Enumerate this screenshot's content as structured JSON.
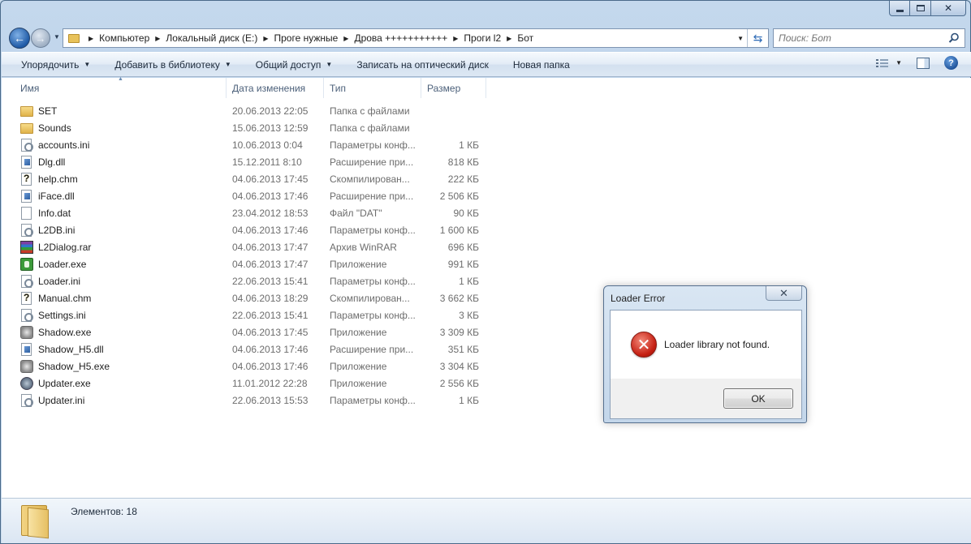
{
  "window": {
    "caption_buttons": {
      "minimize": "minimize",
      "maximize": "maximize",
      "close": "close"
    }
  },
  "address_bar": {
    "crumbs": [
      "Компьютер",
      "Локальный диск (E:)",
      "Проге нужные",
      "Дрова +++++++++++",
      "Проги l2",
      "Бот"
    ]
  },
  "search": {
    "placeholder": "Поиск: Бот"
  },
  "commandbar": {
    "items": [
      {
        "label": "Упорядочить",
        "has_arrow": true
      },
      {
        "label": "Добавить в библиотеку",
        "has_arrow": true
      },
      {
        "label": "Общий доступ",
        "has_arrow": true
      },
      {
        "label": "Записать на оптический диск",
        "has_arrow": false
      },
      {
        "label": "Новая папка",
        "has_arrow": false
      }
    ]
  },
  "columns": {
    "name": "Имя",
    "date": "Дата изменения",
    "type": "Тип",
    "size": "Размер"
  },
  "files": [
    {
      "name": "SET",
      "date": "20.06.2013 22:05",
      "type": "Папка с файлами",
      "size": "",
      "icon": "folder-icon"
    },
    {
      "name": "Sounds",
      "date": "15.06.2013 12:59",
      "type": "Папка с файлами",
      "size": "",
      "icon": "folder-icon"
    },
    {
      "name": "accounts.ini",
      "date": "10.06.2013 0:04",
      "type": "Параметры конф...",
      "size": "1 КБ",
      "icon": "ini-file-icon"
    },
    {
      "name": "Dlg.dll",
      "date": "15.12.2011 8:10",
      "type": "Расширение при...",
      "size": "818 КБ",
      "icon": "dll-file-icon"
    },
    {
      "name": "help.chm",
      "date": "04.06.2013 17:45",
      "type": "Скомпилирован...",
      "size": "222 КБ",
      "icon": "chm-file-icon"
    },
    {
      "name": "iFace.dll",
      "date": "04.06.2013 17:46",
      "type": "Расширение при...",
      "size": "2 506 КБ",
      "icon": "dll-file-icon"
    },
    {
      "name": "Info.dat",
      "date": "23.04.2012 18:53",
      "type": "Файл \"DAT\"",
      "size": "90 КБ",
      "icon": "blank-file-icon"
    },
    {
      "name": "L2DB.ini",
      "date": "04.06.2013 17:46",
      "type": "Параметры конф...",
      "size": "1 600 КБ",
      "icon": "ini-file-icon"
    },
    {
      "name": "L2Dialog.rar",
      "date": "04.06.2013 17:47",
      "type": "Архив WinRAR",
      "size": "696 КБ",
      "icon": "rar-archive-icon"
    },
    {
      "name": "Loader.exe",
      "date": "04.06.2013 17:47",
      "type": "Приложение",
      "size": "991 КБ",
      "icon": "android-exe-icon"
    },
    {
      "name": "Loader.ini",
      "date": "22.06.2013 15:41",
      "type": "Параметры конф...",
      "size": "1 КБ",
      "icon": "ini-file-icon"
    },
    {
      "name": "Manual.chm",
      "date": "04.06.2013 18:29",
      "type": "Скомпилирован...",
      "size": "3 662 КБ",
      "icon": "chm-file-icon"
    },
    {
      "name": "Settings.ini",
      "date": "22.06.2013 15:41",
      "type": "Параметры конф...",
      "size": "3 КБ",
      "icon": "ini-file-icon"
    },
    {
      "name": "Shadow.exe",
      "date": "04.06.2013 17:45",
      "type": "Приложение",
      "size": "3 309 КБ",
      "icon": "shadow-exe-icon"
    },
    {
      "name": "Shadow_H5.dll",
      "date": "04.06.2013 17:46",
      "type": "Расширение при...",
      "size": "351 КБ",
      "icon": "dll-file-icon"
    },
    {
      "name": "Shadow_H5.exe",
      "date": "04.06.2013 17:46",
      "type": "Приложение",
      "size": "3 304 КБ",
      "icon": "shadow-exe-icon"
    },
    {
      "name": "Updater.exe",
      "date": "11.01.2012 22:28",
      "type": "Приложение",
      "size": "2 556 КБ",
      "icon": "updater-exe-icon"
    },
    {
      "name": "Updater.ini",
      "date": "22.06.2013 15:53",
      "type": "Параметры конф...",
      "size": "1 КБ",
      "icon": "ini-file-icon"
    }
  ],
  "status": {
    "text": "Элементов: 18"
  },
  "dialog": {
    "title": "Loader Error",
    "message": "Loader library not found.",
    "ok_label": "OK",
    "close_glyph": "✕"
  }
}
